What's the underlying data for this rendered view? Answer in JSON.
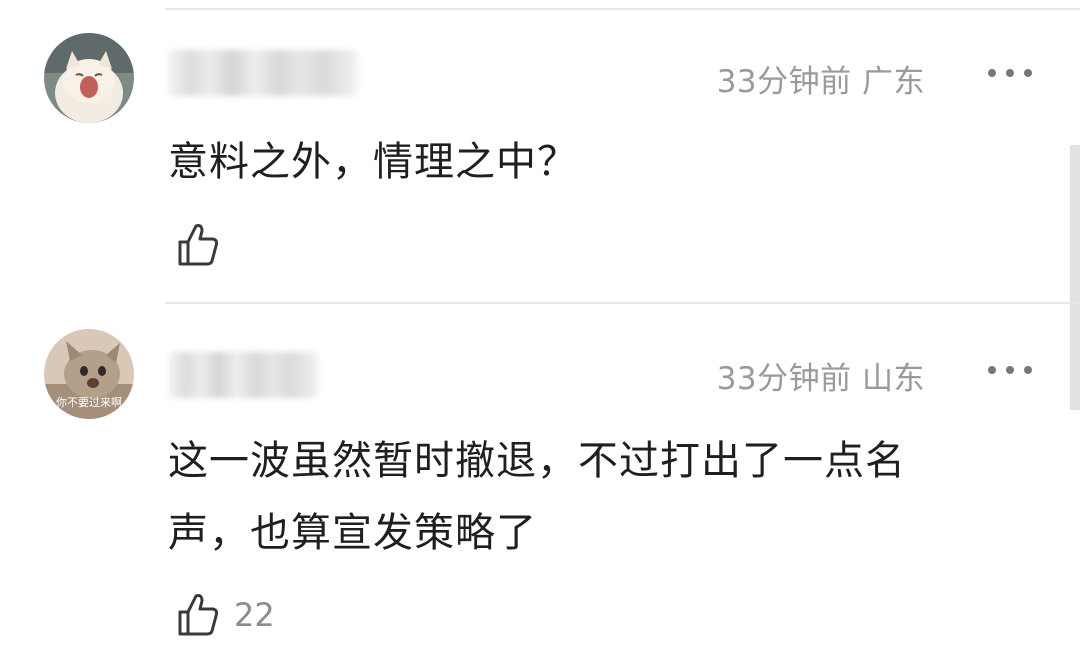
{
  "comments": [
    {
      "avatar_icon": "cat-yawning-avatar",
      "time": "33分钟前",
      "location": "广东",
      "text": "意料之外，情理之中？",
      "likes": ""
    },
    {
      "avatar_icon": "cat-meme-avatar",
      "avatar_caption": "你不要过来啊",
      "time": "33分钟前",
      "location": "山东",
      "text_lines": [
        "这一波虽然暂时撤退，不过打出了一点名",
        "声，也算宣发策略了"
      ],
      "likes": "22"
    }
  ],
  "icons": {
    "more": "more-dots-icon",
    "like": "thumbs-up-icon"
  },
  "colors": {
    "meta": "#9a9a9a",
    "divider": "#e8e8e8",
    "text": "#1f1f1f"
  }
}
